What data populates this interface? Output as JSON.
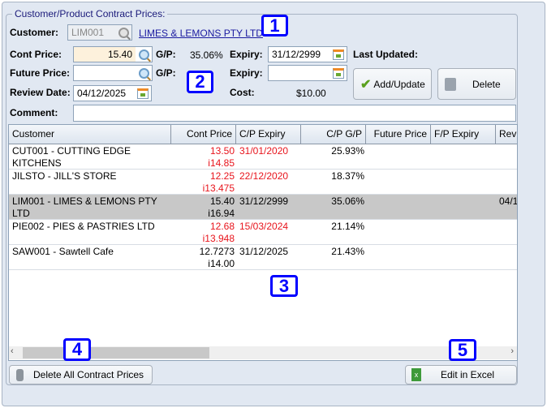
{
  "panel": {
    "title": "Customer/Product Contract Prices:"
  },
  "form": {
    "customer_label": "Customer:",
    "customer_code": "LIM001",
    "customer_name": "LIMES & LEMONS PTY LTD",
    "cont_price_label": "Cont Price:",
    "cont_price_value": "15.40",
    "gp_label": "G/P:",
    "gp_value": "35.06%",
    "expiry_label": "Expiry:",
    "expiry_value": "31/12/2999",
    "last_updated_label": "Last Updated:",
    "future_price_label": "Future Price:",
    "future_price_value": "",
    "future_gp_label": "G/P:",
    "future_expiry_label": "Expiry:",
    "future_expiry_value": "",
    "review_date_label": "Review Date:",
    "review_date_value": "04/12/2025",
    "cost_label": "Cost:",
    "cost_value": "$10.00",
    "comment_label": "Comment:",
    "comment_value": ""
  },
  "buttons": {
    "add_update": "Add/Update",
    "delete": "Delete",
    "delete_all": "Delete All Contract Prices",
    "edit_excel": "Edit in Excel"
  },
  "table": {
    "columns": [
      "Customer",
      "Cont Price",
      "C/P Expiry",
      "C/P G/P",
      "Future Price",
      "F/P Expiry",
      "Rev"
    ],
    "rows": [
      {
        "customer": "CUT001 - CUTTING EDGE",
        "customer2": "KITCHENS",
        "price": "13.50",
        "price2": "i14.85",
        "expiry": "31/01/2020",
        "gp": "25.93%",
        "review": "",
        "expired": true
      },
      {
        "customer": "JILSTO - JILL'S STORE",
        "customer2": "",
        "price": "12.25",
        "price2": "i13.475",
        "expiry": "22/12/2020",
        "gp": "18.37%",
        "review": "",
        "expired": true
      },
      {
        "customer": "LIM001 - LIMES & LEMONS PTY",
        "customer2": "LTD",
        "price": "15.40",
        "price2": "i16.94",
        "expiry": "31/12/2999",
        "gp": "35.06%",
        "review": "04/1",
        "selected": true
      },
      {
        "customer": "PIE002 - PIES & PASTRIES LTD",
        "customer2": "",
        "price": "12.68",
        "price2": "i13.948",
        "expiry": "15/03/2024",
        "gp": "21.14%",
        "review": "",
        "expired": true
      },
      {
        "customer": "SAW001 - Sawtell Cafe",
        "customer2": "",
        "price": "12.7273",
        "price2": "i14.00",
        "expiry": "31/12/2025",
        "gp": "21.43%",
        "review": ""
      }
    ]
  },
  "badges": [
    "1",
    "2",
    "3",
    "4",
    "5"
  ],
  "colors": {
    "expired": "#e8141c",
    "badge": "#0000ff",
    "selected_row": "#c8c8c8",
    "background": "#e1e8f2"
  }
}
